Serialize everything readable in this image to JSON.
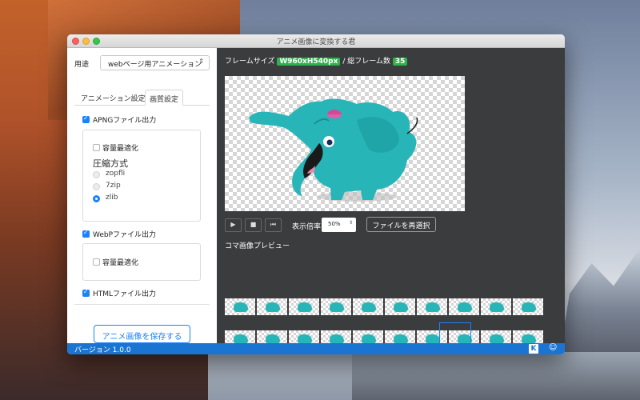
{
  "window": {
    "title": "アニメ画像に変換する君"
  },
  "left": {
    "usage_label": "用途",
    "usage_select": "webページ用アニメーション",
    "tabs": [
      {
        "label": "アニメーション設定"
      },
      {
        "label": "画質設定"
      }
    ],
    "apng": {
      "label": "APNGファイル出力",
      "checked": true,
      "optimize_label": "容量最適化",
      "optimize_checked": false,
      "compress_heading": "圧縮方式",
      "options": [
        {
          "label": "zopfli",
          "selected": false
        },
        {
          "label": "7zip",
          "selected": false
        },
        {
          "label": "zlib",
          "selected": true
        }
      ]
    },
    "webp": {
      "label": "WebPファイル出力",
      "checked": true,
      "optimize_label": "容量最適化",
      "optimize_checked": false
    },
    "html": {
      "label": "HTMLファイル出力",
      "checked": true
    },
    "save_button": "アニメ画像を保存する"
  },
  "right": {
    "frame_size_label": "フレームサイズ",
    "frame_size_value": "W960xH540px",
    "separator": "/",
    "total_frames_label": "総フレーム数",
    "total_frames_value": "35",
    "zoom_label": "表示倍率",
    "zoom_value": "50%",
    "reselect_button": "ファイルを再選択",
    "frames_preview_label": "コマ画像プレビュー"
  },
  "statusbar": {
    "version": "バージョン 1.0.0"
  },
  "colors": {
    "accent": "#1a82fb",
    "badge": "#2fb24e",
    "statusbar": "#1a75d2",
    "dark_panel": "#3a3c3e",
    "elephant": "#27b5b8"
  },
  "icons": [
    "play-icon",
    "stop-icon",
    "step-back-icon",
    "app-logo-icon",
    "smiley-icon"
  ]
}
